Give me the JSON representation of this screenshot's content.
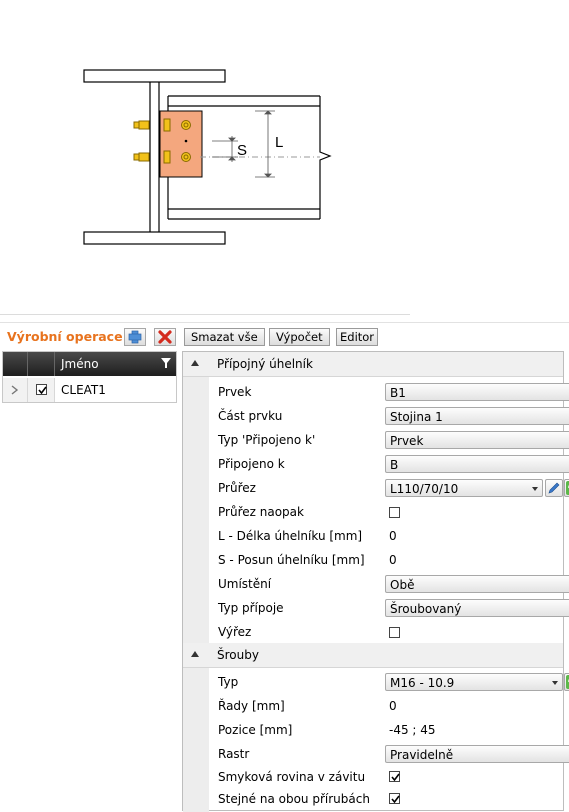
{
  "drawing": {
    "label_s": "S",
    "label_l": "L"
  },
  "toolbar": {
    "title": "Výrobní operace",
    "add_icon": "plus-icon",
    "delete_icon": "delete-x-icon",
    "delete_all_label": "Smazat vše",
    "calculate_label": "Výpočet",
    "editor_label": "Editor"
  },
  "grid": {
    "header_name": "Jméno",
    "rows": [
      {
        "name": "CLEAT1",
        "checked": true
      }
    ]
  },
  "properties": {
    "section_cleat": "Přípojný úhelník",
    "prvek_label": "Prvek",
    "prvek_value": "B1",
    "cast_label": "Část prvku",
    "cast_value": "Stojina 1",
    "typ_pripojeno_label": "Typ 'Připojeno k'",
    "typ_pripojeno_value": "Prvek",
    "pripojeno_label": "Připojeno k",
    "pripojeno_value": "B",
    "prurez_label": "Průřez",
    "prurez_value": "L110/70/10",
    "prurez_naopak_label": "Průřez naopak",
    "prurez_naopak_checked": false,
    "delka_label": "L - Délka úhelníku [mm]",
    "delka_value": "0",
    "posun_label": "S - Posun úhelníku [mm]",
    "posun_value": "0",
    "umisteni_label": "Umístění",
    "umisteni_value": "Obě",
    "typ_pripoje_label": "Typ přípoje",
    "typ_pripoje_value": "Šroubovaný",
    "vyrez_label": "Výřez",
    "vyrez_checked": false,
    "section_bolts": "Šrouby",
    "typ_label": "Typ",
    "typ_value": "M16 - 10.9",
    "rady_label": "Řady [mm]",
    "rady_value": "0",
    "pozice_label": "Pozice [mm]",
    "pozice_value": "-45 ; 45",
    "rastr_label": "Rastr",
    "rastr_value": "Pravidelně",
    "smykova_label": "Smyková rovina v závitu",
    "smykova_checked": true,
    "stejne_label": "Stejné na obou přírubách",
    "stejne_checked": true
  },
  "colors": {
    "accent": "#e8731e",
    "plate": "#f4a77e",
    "bolt": "#f2c21a"
  }
}
